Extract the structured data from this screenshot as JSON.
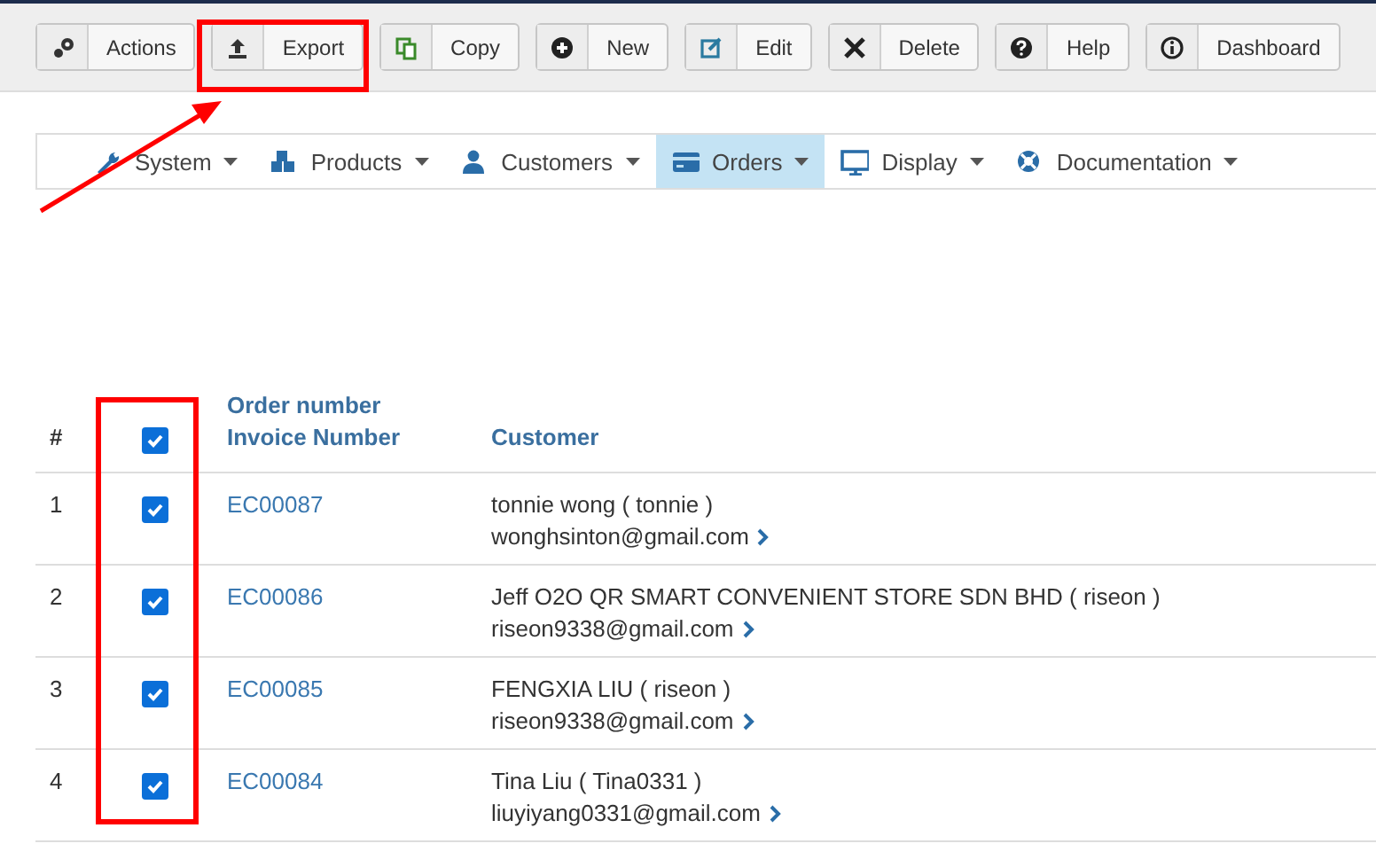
{
  "toolbar": [
    {
      "label": "Actions"
    },
    {
      "label": "Export"
    },
    {
      "label": "Copy"
    },
    {
      "label": "New"
    },
    {
      "label": "Edit"
    },
    {
      "label": "Delete"
    },
    {
      "label": "Help"
    },
    {
      "label": "Dashboard"
    }
  ],
  "menu": [
    {
      "label": "System",
      "selected": false
    },
    {
      "label": "Products",
      "selected": false
    },
    {
      "label": "Customers",
      "selected": false
    },
    {
      "label": "Orders",
      "selected": true
    },
    {
      "label": "Display",
      "selected": false
    },
    {
      "label": "Documentation",
      "selected": false
    }
  ],
  "table": {
    "columns": [
      "#",
      "Order number",
      "Invoice Number",
      "Customer"
    ],
    "select_all_checked": true,
    "rows": [
      {
        "index": "1",
        "checked": true,
        "order": "EC00087",
        "customer": "tonnie wong ( tonnie )",
        "email": "wonghsinton@gmail.com"
      },
      {
        "index": "2",
        "checked": true,
        "order": "EC00086",
        "customer": "Jeff O2O QR SMART CONVENIENT STORE SDN BHD ( riseon )",
        "email": "riseon9338@gmail.com"
      },
      {
        "index": "3",
        "checked": true,
        "order": "EC00085",
        "customer": "FENGXIA LIU ( riseon )",
        "email": "riseon9338@gmail.com"
      },
      {
        "index": "4",
        "checked": true,
        "order": "EC00084",
        "customer": "Tina Liu ( Tina0331 )",
        "email": "liuyiyang0331@gmail.com"
      }
    ]
  }
}
